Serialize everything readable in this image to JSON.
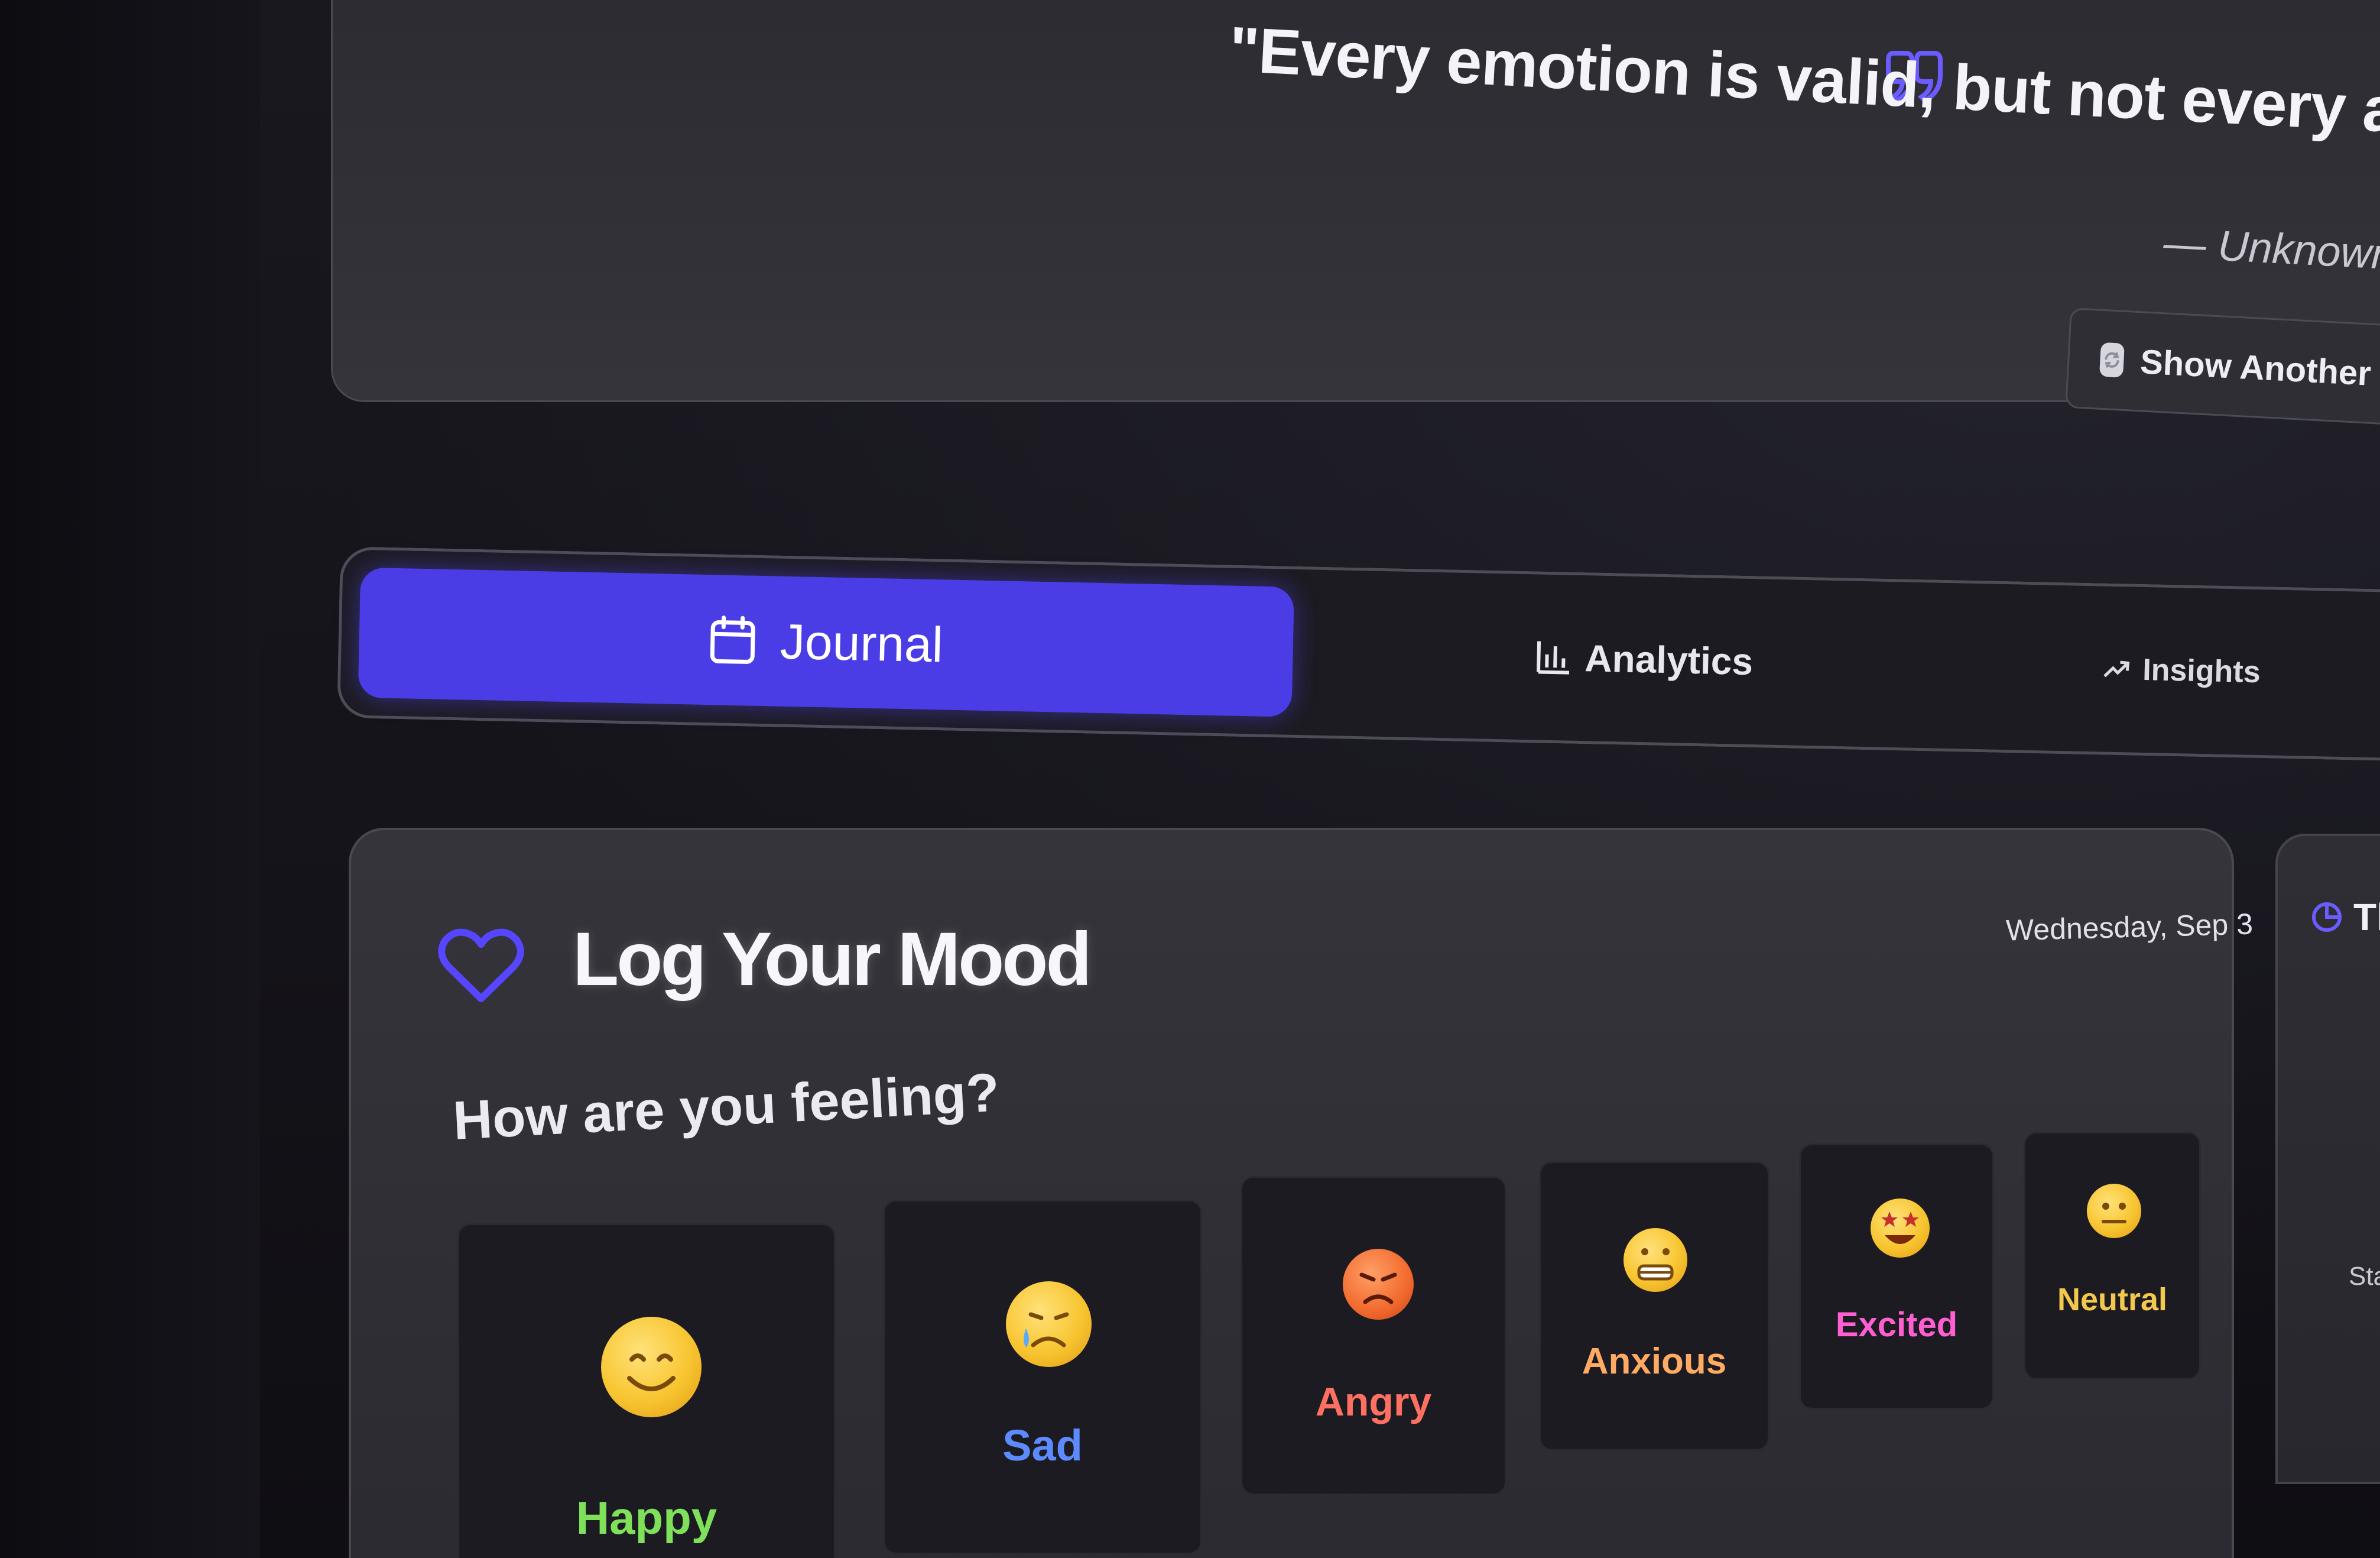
{
  "quote": {
    "text": "\"Every emotion is valid, but not every action is productive.\"",
    "author": "— Unknown",
    "button_label": "Show Another Quote"
  },
  "tabs": [
    {
      "label": "Journal",
      "icon": "calendar-icon",
      "active": true
    },
    {
      "label": "Analytics",
      "icon": "bar-chart-icon",
      "active": false
    },
    {
      "label": "Insights",
      "icon": "trend-up-icon",
      "active": false
    }
  ],
  "mood_log": {
    "title": "Log Your Mood",
    "date": "Wednesday, Sep 3",
    "prompt": "How are you feeling?",
    "options": [
      {
        "label": "Happy",
        "emoji": "😊",
        "color": "#7fe05a"
      },
      {
        "label": "Sad",
        "emoji": "😢",
        "color": "#5d8bff"
      },
      {
        "label": "Angry",
        "emoji": "😠",
        "color": "#ff7063"
      },
      {
        "label": "Anxious",
        "emoji": "😬",
        "color": "#ffab63"
      },
      {
        "label": "Excited",
        "emoji": "🤩",
        "color": "#ff5fd3"
      },
      {
        "label": "Neutral",
        "emoji": "😐",
        "color": "#f2c84d"
      }
    ]
  },
  "side_panel": {
    "title_fragment": "Th",
    "body_fragment": "Star"
  },
  "colors": {
    "accent": "#4b3de6",
    "background": "#141319",
    "card": "#333238"
  }
}
